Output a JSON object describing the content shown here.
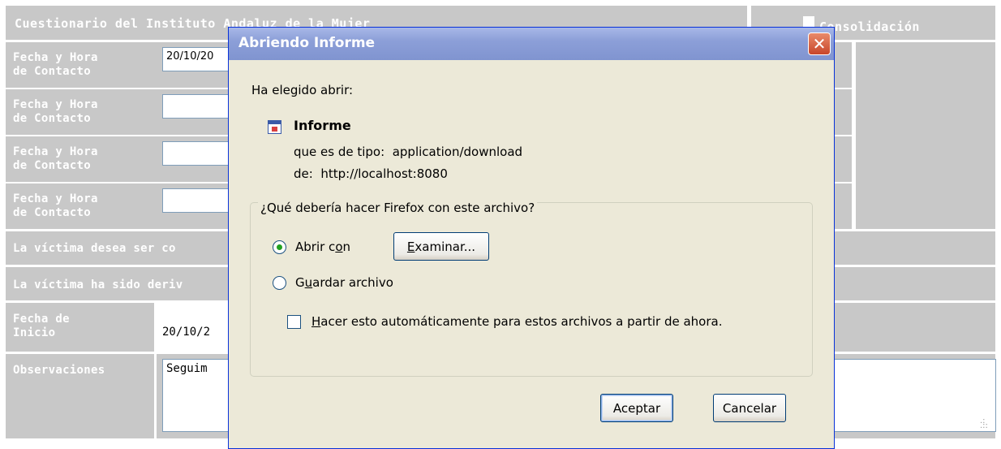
{
  "form": {
    "header_title": "Cuestionario del Instituto Andaluz de la Mujer",
    "consolidacion_label": "Consolidación",
    "contact_rows": [
      {
        "label_line1": "Fecha y Hora",
        "label_line2": "de Contacto",
        "value": "20/10/20"
      },
      {
        "label_line1": "Fecha y Hora",
        "label_line2": "de Contacto",
        "value": ""
      },
      {
        "label_line1": "Fecha y Hora",
        "label_line2": "de Contacto",
        "value": ""
      },
      {
        "label_line1": "Fecha y Hora",
        "label_line2": "de Contacto",
        "value": ""
      }
    ],
    "row_victima_contactada": "La víctima desea ser co",
    "row_victima_derivada": "La víctima ha sido deriv",
    "fecha_inicio_line1": "Fecha de",
    "fecha_inicio_line2": "Inicio",
    "fecha_inicio_value": "20/10/2",
    "observaciones_label": "Observaciones",
    "observaciones_value": "Seguim"
  },
  "dialog": {
    "title": "Abriendo Informe",
    "close_symbol": "✕",
    "intro": "Ha elegido abrir:",
    "file_name": "Informe",
    "type_label": "que es de tipo:",
    "type_value": "application/download",
    "from_label": "de:",
    "from_value": "http://localhost:8080",
    "question": "¿Qué debería hacer Firefox con este archivo?",
    "open_with": {
      "pre": "Abrir c",
      "accel": "o",
      "post": "n",
      "selected": true
    },
    "browse_button": {
      "accel": "E",
      "rest": "xaminar..."
    },
    "save_file": {
      "pre": "G",
      "accel": "u",
      "post": "ardar archivo",
      "selected": false
    },
    "auto": {
      "accel": "H",
      "rest": "acer esto automáticamente para estos archivos a partir de ahora.",
      "checked": false
    },
    "ok_button": "Aceptar",
    "cancel_button": "Cancelar"
  },
  "colors": {
    "form_gray": "#c8c8c8",
    "dialog_bg": "#ece9d8",
    "titlebar": "#8c9fd8",
    "close_red": "#c8462a"
  }
}
